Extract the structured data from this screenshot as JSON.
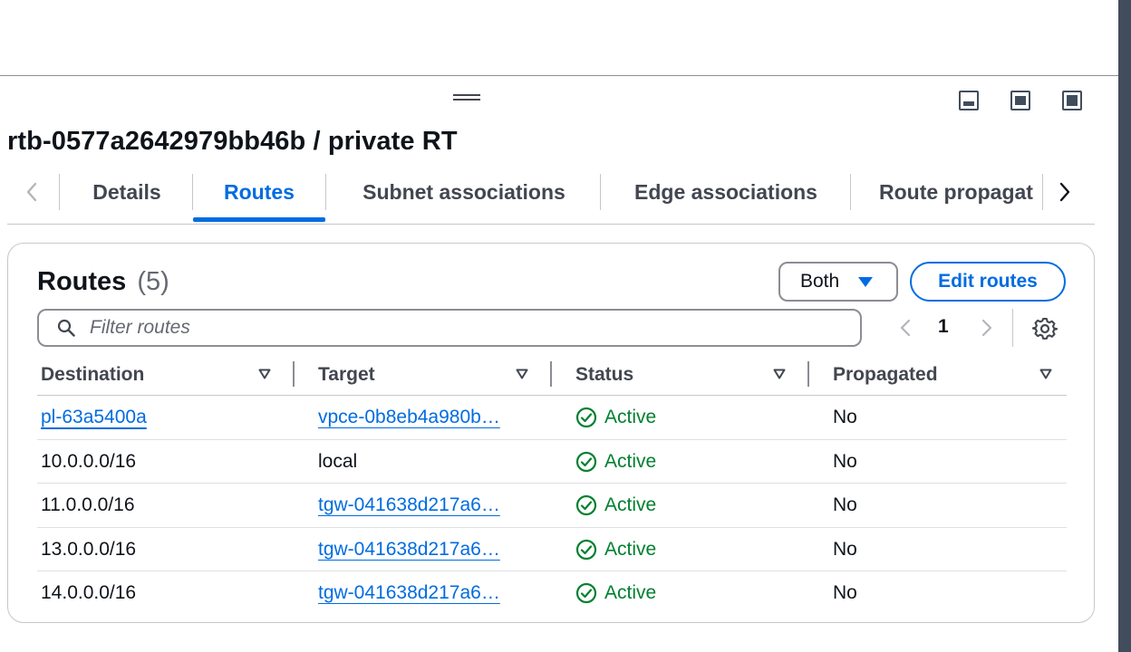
{
  "page_title": "rtb-0577a2642979bb46b / private RT",
  "tabs": [
    {
      "label": "Details"
    },
    {
      "label": "Routes"
    },
    {
      "label": "Subnet associations"
    },
    {
      "label": "Edge associations"
    },
    {
      "label": "Route propagat"
    }
  ],
  "active_tab": "Routes",
  "routes": {
    "title": "Routes",
    "count": "(5)",
    "filter_button_label": "Both",
    "edit_button_label": "Edit routes",
    "search_placeholder": "Filter routes",
    "search_value": "",
    "page_number": "1",
    "columns": [
      "Destination",
      "Target",
      "Status",
      "Propagated"
    ],
    "rows": [
      {
        "destination": "pl-63a5400a",
        "destination_is_link": true,
        "target": "vpce-0b8eb4a980b…",
        "target_is_link": true,
        "status": "Active",
        "propagated": "No"
      },
      {
        "destination": "10.0.0.0/16",
        "destination_is_link": false,
        "target": "local",
        "target_is_link": false,
        "status": "Active",
        "propagated": "No"
      },
      {
        "destination": "11.0.0.0/16",
        "destination_is_link": false,
        "target": "tgw-041638d217a6…",
        "target_is_link": true,
        "status": "Active",
        "propagated": "No"
      },
      {
        "destination": "13.0.0.0/16",
        "destination_is_link": false,
        "target": "tgw-041638d217a6…",
        "target_is_link": true,
        "status": "Active",
        "propagated": "No"
      },
      {
        "destination": "14.0.0.0/16",
        "destination_is_link": false,
        "target": "tgw-041638d217a6…",
        "target_is_link": true,
        "status": "Active",
        "propagated": "No"
      }
    ]
  },
  "colors": {
    "accent": "#006ce0",
    "success": "#00802f",
    "text": "#0f141a",
    "muted": "#424650"
  },
  "icons": {
    "tab_prev": "chevron-left-icon",
    "tab_next": "chevron-right-icon",
    "search": "search-icon",
    "settings": "gear-icon",
    "status": "check-circle-icon",
    "sort": "caret-down-icon"
  }
}
